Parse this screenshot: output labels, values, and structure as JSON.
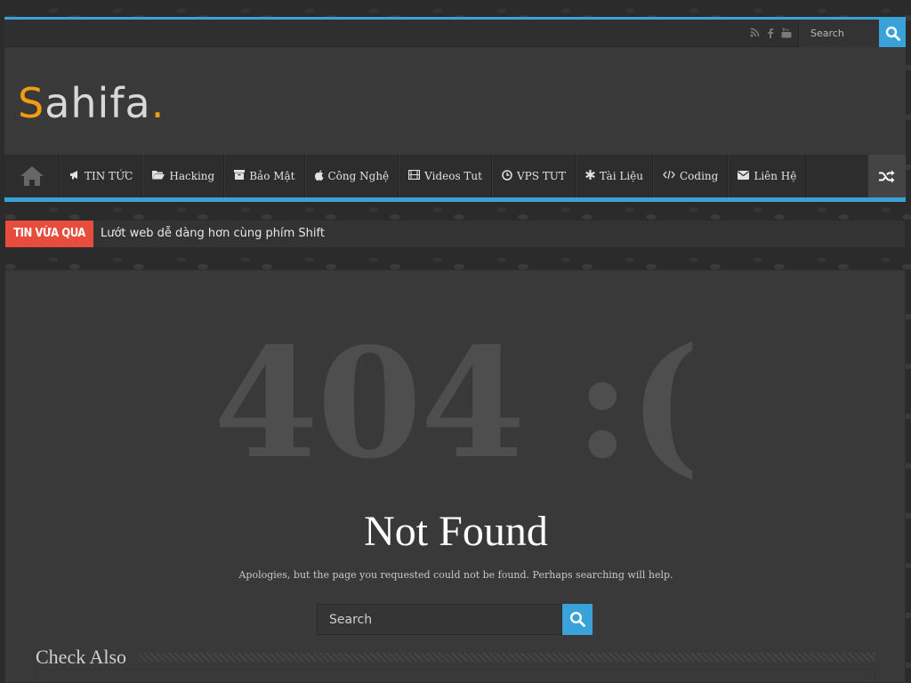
{
  "top_bar": {
    "social_icons": [
      "rss-icon",
      "facebook-icon",
      "youtube-icon"
    ],
    "search_placeholder": "Search"
  },
  "header": {
    "logo": {
      "first": "S",
      "rest": "ahifa",
      "dot": "."
    }
  },
  "nav": {
    "items": [
      {
        "icon": "megaphone-icon",
        "glyph": "📢",
        "label": "TIN TỨC"
      },
      {
        "icon": "folder-icon",
        "glyph": "📂",
        "label": "Hacking"
      },
      {
        "icon": "archive-icon",
        "glyph": "▣",
        "label": "Bảo Mật"
      },
      {
        "icon": "apple-icon",
        "glyph": "",
        "label": "Công Nghệ"
      },
      {
        "icon": "film-icon",
        "glyph": "▤",
        "label": "Videos Tut"
      },
      {
        "icon": "clock-icon",
        "glyph": "◷",
        "label": "VPS TUT"
      },
      {
        "icon": "asterisk-icon",
        "glyph": "✱",
        "label": "Tài Liệu"
      },
      {
        "icon": "code-icon",
        "glyph": "</>",
        "label": "Coding"
      },
      {
        "icon": "envelope-icon",
        "glyph": "✉",
        "label": "Liên Hệ"
      }
    ]
  },
  "breaking": {
    "label": "TIN VỪA QUA",
    "text": "Lướt web dễ dàng hơn cùng phím Shift"
  },
  "error": {
    "code": "404 :(",
    "title": "Not Found",
    "message": "Apologies, but the page you requested could not be found. Perhaps searching will help.",
    "search_placeholder": "Search"
  },
  "check_also": {
    "title": "Check Also"
  },
  "colors": {
    "accent": "#39a3d9",
    "logo_accent": "#f39c12",
    "breaking": "#e74c3c"
  }
}
